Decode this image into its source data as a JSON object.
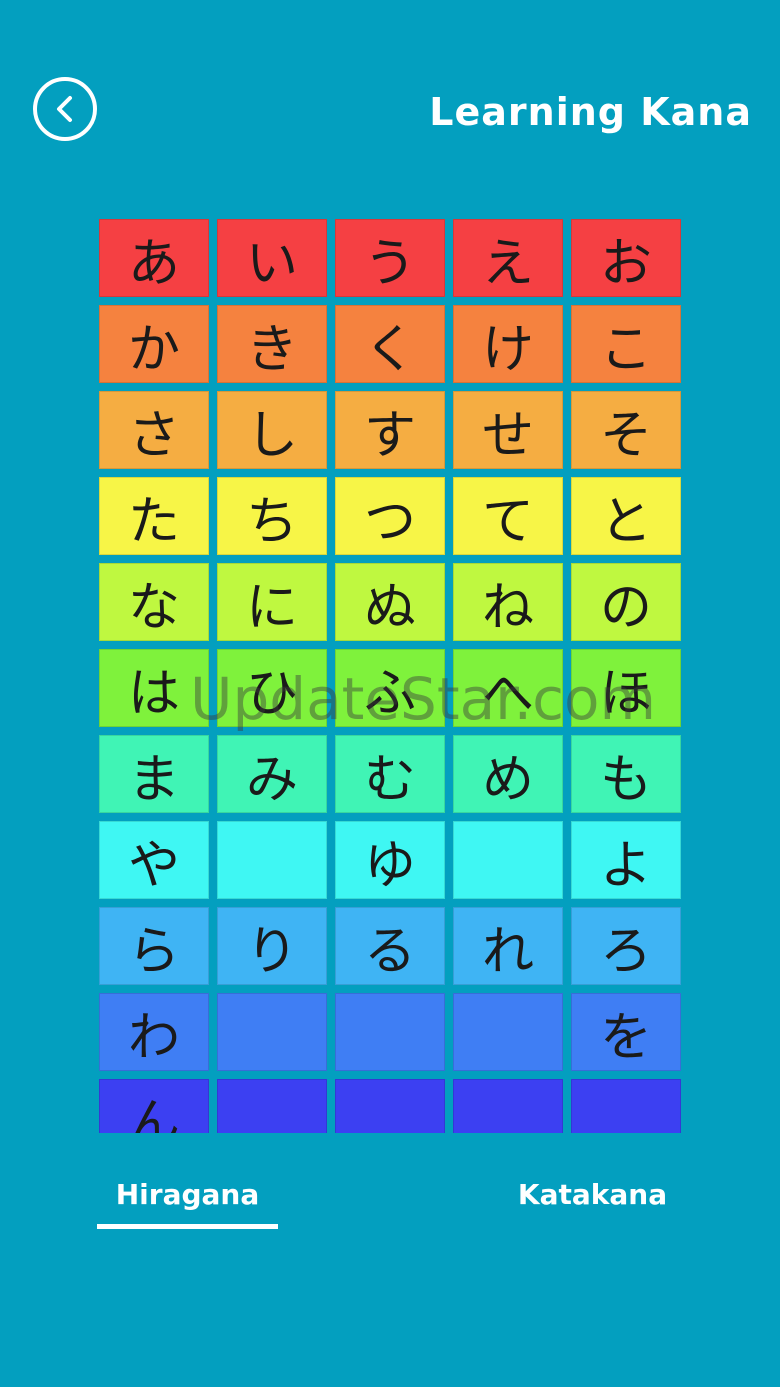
{
  "header": {
    "back_icon": "chevron-left-icon",
    "title": "Learning Kana"
  },
  "kana_grid": {
    "rows": [
      {
        "color": "#f54043",
        "cells": [
          "あ",
          "い",
          "う",
          "え",
          "お"
        ]
      },
      {
        "color": "#f5823f",
        "cells": [
          "か",
          "き",
          "く",
          "け",
          "こ"
        ]
      },
      {
        "color": "#f5ad42",
        "cells": [
          "さ",
          "し",
          "す",
          "せ",
          "そ"
        ]
      },
      {
        "color": "#f7f547",
        "cells": [
          "た",
          "ち",
          "つ",
          "て",
          "と"
        ]
      },
      {
        "color": "#bff840",
        "cells": [
          "な",
          "に",
          "ぬ",
          "ね",
          "の"
        ]
      },
      {
        "color": "#7ff23c",
        "cells": [
          "は",
          "ひ",
          "ふ",
          "へ",
          "ほ"
        ]
      },
      {
        "color": "#40f4b5",
        "cells": [
          "ま",
          "み",
          "む",
          "め",
          "も"
        ]
      },
      {
        "color": "#3ff7f3",
        "cells": [
          "や",
          "",
          "ゆ",
          "",
          "よ"
        ]
      },
      {
        "color": "#3fb4f4",
        "cells": [
          "ら",
          "り",
          "る",
          "れ",
          "ろ"
        ]
      },
      {
        "color": "#3f7ef4",
        "cells": [
          "わ",
          "",
          "",
          "",
          "を"
        ]
      },
      {
        "color": "#3c40f2",
        "cells": [
          "ん",
          "",
          "",
          "",
          ""
        ]
      }
    ]
  },
  "tabs": {
    "hiragana": "Hiragana",
    "katakana": "Katakana",
    "active": "hiragana"
  },
  "watermark": "UpdateStar.com"
}
